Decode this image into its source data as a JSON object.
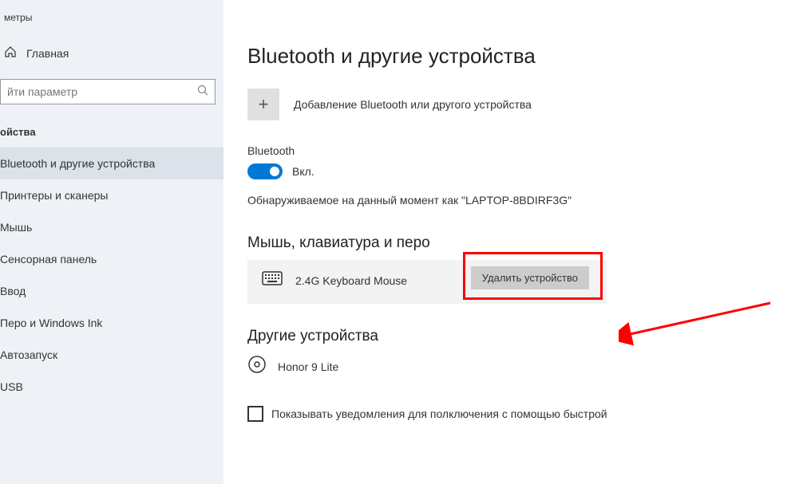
{
  "window": {
    "title": "метры"
  },
  "sidebar": {
    "home": "Главная",
    "search_placeholder": "йти параметр",
    "section": "ойства",
    "items": [
      {
        "label": "Bluetooth и другие устройства"
      },
      {
        "label": "Принтеры и сканеры"
      },
      {
        "label": "Мышь"
      },
      {
        "label": "Сенсорная панель"
      },
      {
        "label": "Ввод"
      },
      {
        "label": "Перо и Windows Ink"
      },
      {
        "label": "Автозапуск"
      },
      {
        "label": "USB"
      }
    ]
  },
  "main": {
    "title": "Bluetooth и другие устройства",
    "add_device": "Добавление Bluetooth или другого устройства",
    "bt_label": "Bluetooth",
    "toggle_state": "Вкл.",
    "discoverable": "Обнаруживаемое на данный момент как \"LAPTOP-8BDIRF3G\"",
    "section_mouse": "Мышь, клавиатура и перо",
    "device1": "2.4G Keyboard Mouse",
    "remove_btn": "Удалить устройство",
    "section_other": "Другие устройства",
    "device2": "Honor 9 Lite",
    "checkbox_label": "Показывать уведомления для полключения с помощью быстрой"
  }
}
